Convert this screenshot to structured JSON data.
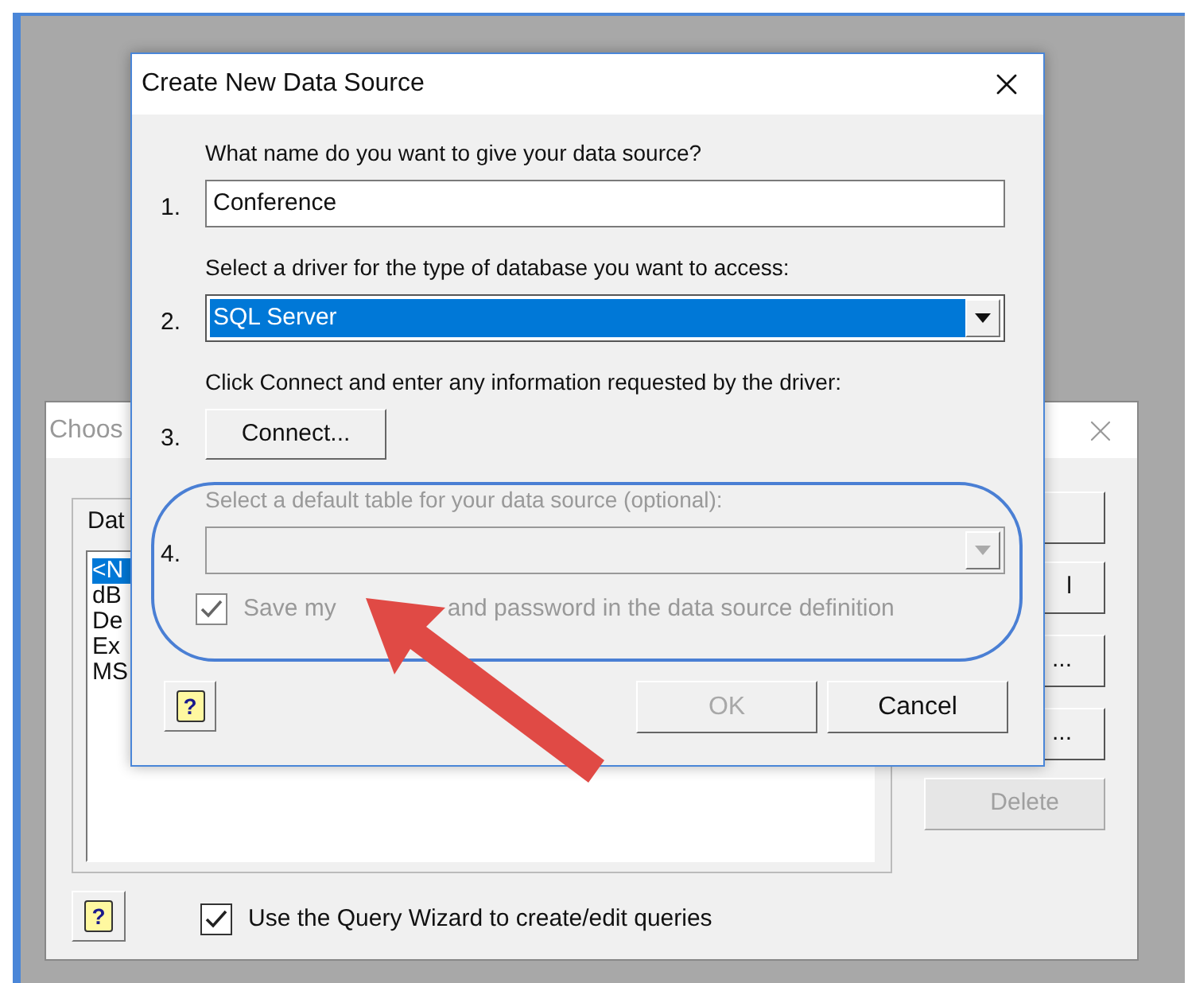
{
  "background_dialog": {
    "title": "Choos",
    "tab_label": "Dat",
    "list_items": [
      {
        "text": "<N",
        "selected": true
      },
      {
        "text": "dB",
        "selected": false
      },
      {
        "text": "De",
        "selected": false
      },
      {
        "text": "Ex",
        "selected": false
      },
      {
        "text": "MS",
        "selected": false
      }
    ],
    "side_buttons": [
      {
        "disabled": false
      },
      {
        "label": "l",
        "disabled": false
      },
      {
        "label": "...",
        "disabled": false
      },
      {
        "label": "...",
        "disabled": false
      },
      {
        "label": "Delete",
        "disabled": true
      }
    ],
    "help_label": "?",
    "query_wizard": {
      "label": "Use the Query Wizard to create/edit queries",
      "checked": true
    }
  },
  "dialog": {
    "title": "Create New Data Source",
    "steps": [
      {
        "number": "1.",
        "prompt": "What name do you want to give your data source?",
        "kind": "text",
        "value": "Conference",
        "disabled": false
      },
      {
        "number": "2.",
        "prompt": "Select a driver for the type of database you want to access:",
        "kind": "select",
        "value": "SQL Server",
        "disabled": false
      },
      {
        "number": "3.",
        "prompt": "Click Connect and enter any information requested by the driver:",
        "kind": "button",
        "value": "Connect...",
        "disabled": false
      },
      {
        "number": "4.",
        "prompt": "Select a default table for your data source (optional):",
        "kind": "select",
        "disabled": true
      }
    ],
    "save_password": {
      "label_start": "Save my",
      "label_end": "and password in the data source definition",
      "checked": true,
      "disabled": true
    },
    "help_label": "?",
    "buttons": [
      {
        "label": "OK",
        "disabled": true
      },
      {
        "label": "Cancel",
        "disabled": false
      }
    ]
  }
}
